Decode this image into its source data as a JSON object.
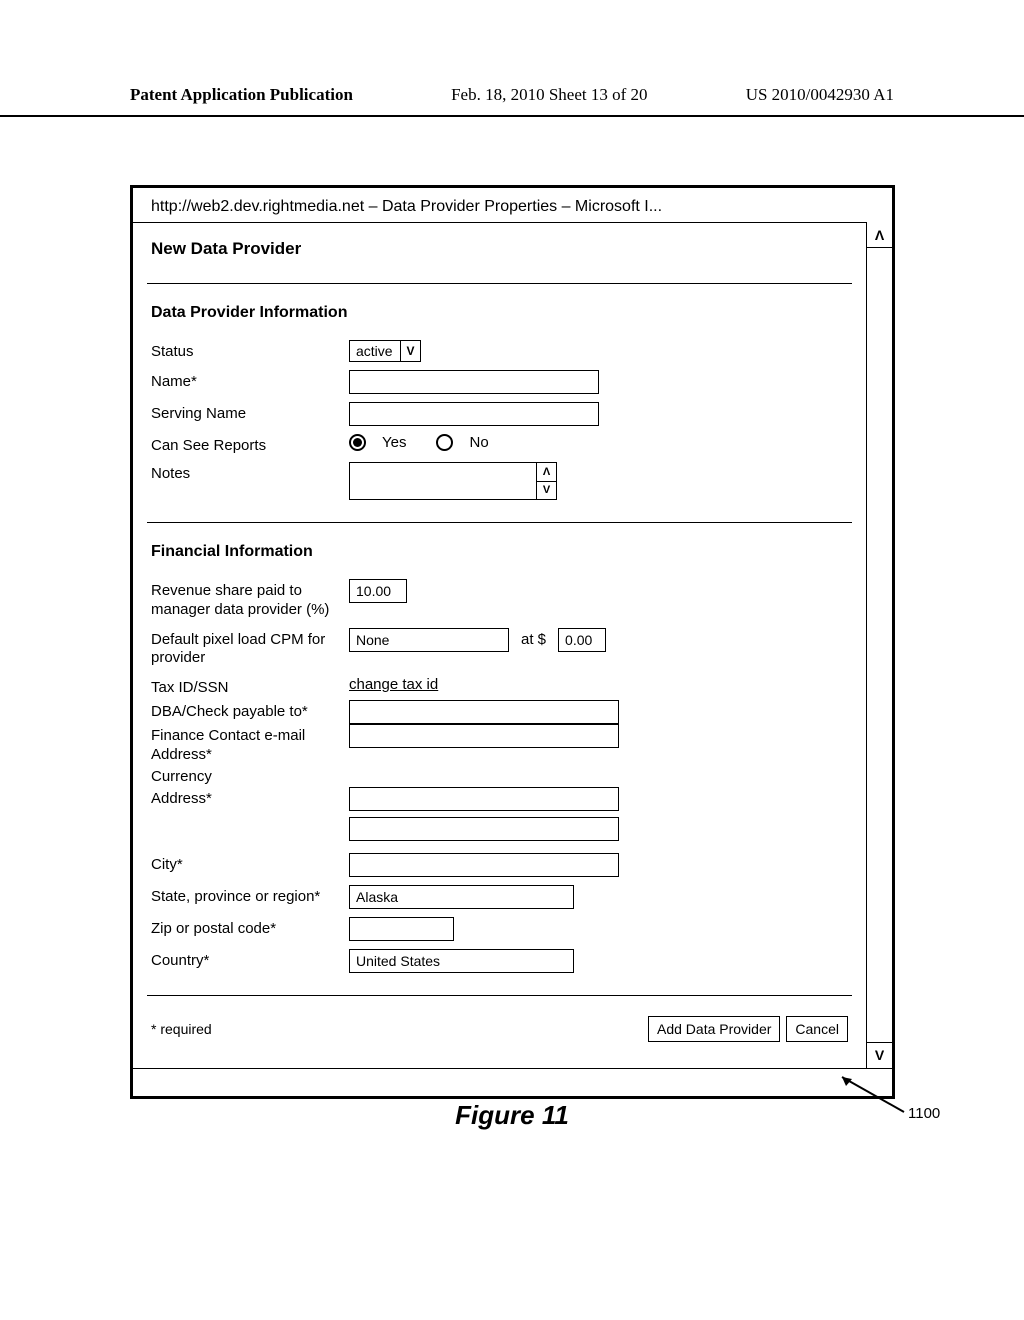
{
  "header": {
    "left": "Patent Application Publication",
    "center": "Feb. 18, 2010  Sheet 13 of 20",
    "right": "US 2010/0042930 A1"
  },
  "window": {
    "title": "http://web2.dev.rightmedia.net – Data Provider Properties – Microsoft I..."
  },
  "form": {
    "panel_title": "New Data Provider",
    "section1": {
      "heading": "Data Provider Information",
      "status_label": "Status",
      "status_value": "active",
      "name_label": "Name*",
      "name_value": "",
      "serving_name_label": "Serving Name",
      "serving_name_value": "",
      "reports_label": "Can See Reports",
      "reports_yes": "Yes",
      "reports_no": "No",
      "notes_label": "Notes",
      "notes_value": ""
    },
    "section2": {
      "heading": "Financial Information",
      "revshare_label": "Revenue share paid to manager data provider (%)",
      "revshare_value": "10.00",
      "cpm_label": "Default pixel load CPM for provider",
      "cpm_select_value": "None",
      "cpm_at": "at $",
      "cpm_value": "0.00",
      "taxid_label": "Tax ID/SSN",
      "taxid_link": "change tax id",
      "dba_label": "DBA/Check payable to*",
      "dba_value": "",
      "email_label": "Finance Contact e-mail Address*",
      "email_value": "",
      "currency_label": "Currency",
      "address_label": "Address*",
      "address1_value": "",
      "address2_value": "",
      "city_label": "City*",
      "city_value": "",
      "state_label": "State, province or region*",
      "state_value": "Alaska",
      "zip_label": "Zip or postal code*",
      "zip_value": "",
      "country_label": "Country*",
      "country_value": "United States"
    },
    "footer": {
      "required_note": "* required",
      "submit_label": "Add Data Provider",
      "cancel_label": "Cancel"
    }
  },
  "figure": {
    "caption": "Figure 11",
    "ref_num": "1100"
  },
  "glyphs": {
    "down": "V",
    "up_caret": "Λ",
    "down_caret": "V"
  }
}
